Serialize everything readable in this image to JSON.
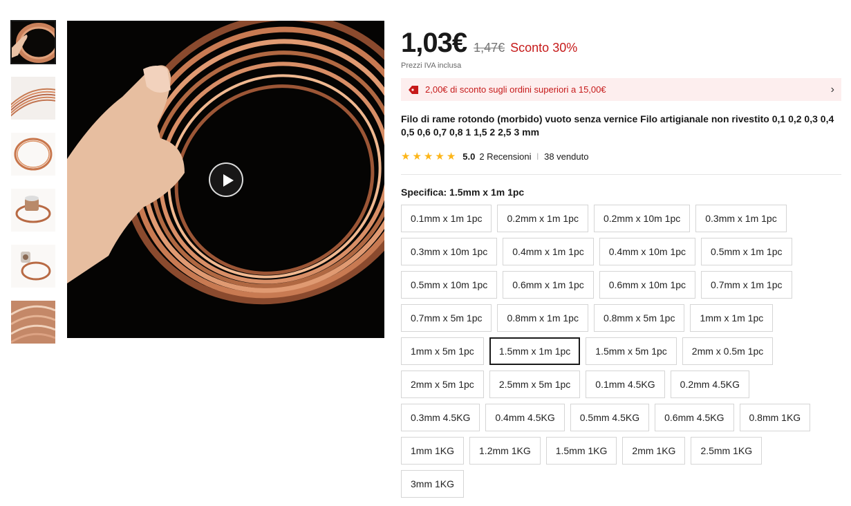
{
  "thumbnails": [
    {
      "name": "thumb-hand-holding-wire"
    },
    {
      "name": "thumb-wire-closeup"
    },
    {
      "name": "thumb-wire-coil"
    },
    {
      "name": "thumb-wire-spool"
    },
    {
      "name": "thumb-wire-spool-side"
    },
    {
      "name": "thumb-wire-strands"
    }
  ],
  "product": {
    "price": "1,03€",
    "old_price": "1,47€",
    "discount": "Sconto 30%",
    "vat_note": "Prezzi IVA inclusa",
    "coupon_text": "2,00€ di sconto sugli ordini superiori a 15,00€",
    "title": "Filo di rame rotondo (morbido) vuoto senza vernice Filo artigianale non rivestito 0,1 0,2 0,3 0,4 0,5 0,6 0,7 0,8 1 1,5 2 2,5 3 mm",
    "rating": "5.0",
    "reviews": "2 Recensioni",
    "separator": "|",
    "sold": "38 venduto"
  },
  "spec": {
    "label": "Specifica: 1.5mm x 1m 1pc",
    "selected": "1.5mm x 1m 1pc",
    "options": [
      "0.1mm x 1m 1pc",
      "0.2mm x 1m 1pc",
      "0.2mm x 10m 1pc",
      "0.3mm x 1m 1pc",
      "0.3mm x 10m 1pc",
      "0.4mm x 1m 1pc",
      "0.4mm x 10m 1pc",
      "0.5mm x 1m 1pc",
      "0.5mm x 10m 1pc",
      "0.6mm x 1m 1pc",
      "0.6mm x 10m 1pc",
      "0.7mm x 1m 1pc",
      "0.7mm x 5m 1pc",
      "0.8mm x 1m 1pc",
      "0.8mm x 5m 1pc",
      "1mm x 1m 1pc",
      "1mm x 5m 1pc",
      "1.5mm x 1m 1pc",
      "1.5mm x 5m 1pc",
      "2mm x 0.5m 1pc",
      "2mm x 5m 1pc",
      "2.5mm x 5m 1pc",
      "0.1mm 4.5KG",
      "0.2mm 4.5KG",
      "0.3mm 4.5KG",
      "0.4mm 4.5KG",
      "0.5mm 4.5KG",
      "0.6mm 4.5KG",
      "0.8mm 1KG",
      "1mm 1KG",
      "1.2mm 1KG",
      "1.5mm 1KG",
      "2mm 1KG",
      "2.5mm 1KG",
      "3mm 1KG"
    ]
  },
  "icons": {
    "star": "★",
    "chevron": "›"
  },
  "colors": {
    "accent_red": "#c61a1a",
    "star_yellow": "#fdb619",
    "coupon_bg": "#fdeeee"
  }
}
